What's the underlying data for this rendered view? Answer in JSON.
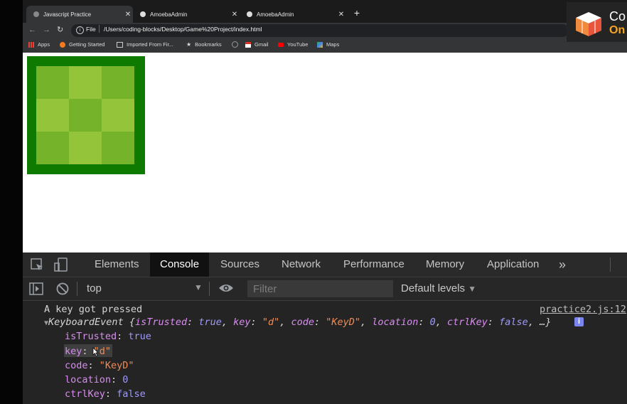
{
  "browser": {
    "tabs": [
      {
        "title": "Javascript Practice",
        "active": true
      },
      {
        "title": "AmoebaAdmin",
        "active": false
      },
      {
        "title": "AmoebaAdmin",
        "active": false
      }
    ],
    "new_tab_label": "+",
    "address": {
      "scheme_label": "File",
      "url": "/Users/coding-blocks/Desktop/Game%20Project/index.html"
    },
    "bookmarks": [
      {
        "label": "Apps",
        "icon": "apps-grid-icon"
      },
      {
        "label": "Getting Started",
        "icon": "firefox-icon"
      },
      {
        "label": "Imported From Fir...",
        "icon": "folder-icon"
      },
      {
        "label": "Bookmarks",
        "icon": "star-icon"
      },
      {
        "label": "",
        "icon": "github-icon"
      },
      {
        "label": "Gmail",
        "icon": "gmail-icon"
      },
      {
        "label": "YouTube",
        "icon": "youtube-icon"
      },
      {
        "label": "Maps",
        "icon": "maps-icon"
      }
    ]
  },
  "overlay_logo": {
    "line1": "Co",
    "line2": "On"
  },
  "game": {
    "grid_rows": 3,
    "grid_cols": 3,
    "colors": {
      "border": "#0e7a00",
      "light": "#93c43a",
      "dark": "#74b32a"
    }
  },
  "devtools": {
    "tabs": [
      "Elements",
      "Console",
      "Sources",
      "Network",
      "Performance",
      "Memory",
      "Application"
    ],
    "active_tab": "Console",
    "more_label": "»",
    "context": "top",
    "filter_placeholder": "Filter",
    "levels": "Default levels",
    "console": {
      "log_text": "A key got pressed",
      "source_link": "practice2.js:12",
      "event_summary": {
        "prefix": "KeyboardEvent {",
        "isTrusted_key": "isTrusted",
        "isTrusted_val": "true",
        "key_key": "key",
        "key_val": "\"d\"",
        "code_key": "code",
        "code_val": "\"KeyD\"",
        "location_key": "location",
        "location_val": "0",
        "ctrlKey_key": "ctrlKey",
        "ctrlKey_val": "false",
        "suffix": "…}"
      },
      "props": [
        {
          "key": "isTrusted",
          "value": "true",
          "kind": "bool"
        },
        {
          "key": "key",
          "value": "\"d\"",
          "kind": "string"
        },
        {
          "key": "code",
          "value": "\"KeyD\"",
          "kind": "string"
        },
        {
          "key": "location",
          "value": "0",
          "kind": "number"
        },
        {
          "key": "ctrlKey",
          "value": "false",
          "kind": "bool"
        }
      ]
    }
  }
}
